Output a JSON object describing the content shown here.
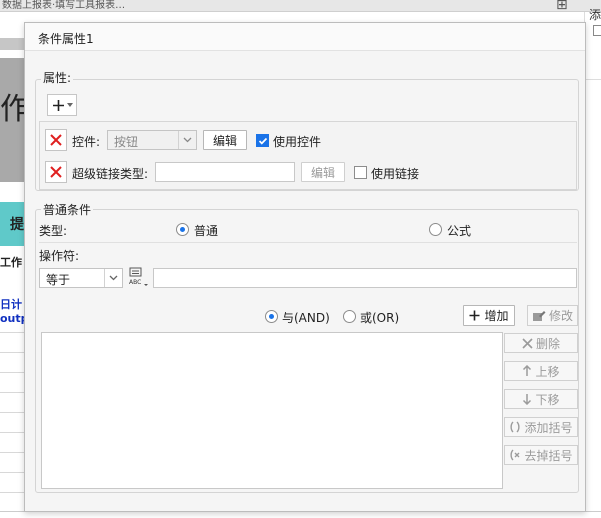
{
  "background": {
    "tab_text": "数据上报表·填写工具报表…",
    "left_big_char": "作",
    "left_teal_char": "提",
    "left_label_1": "工作",
    "left_link_1": "日计",
    "left_link_2": "outp",
    "right_tab_text": "添"
  },
  "dialog": {
    "title": "条件属性1",
    "attributes": {
      "legend": "属性:",
      "add_icon": "plus-icon",
      "rows": [
        {
          "label": "控件:",
          "combo_value": "按钮",
          "edit_label": "编辑",
          "checkbox_label": "使用控件",
          "checked": true
        },
        {
          "label": "超级链接类型:",
          "input_value": "",
          "edit_label": "编辑",
          "checkbox_label": "使用链接",
          "checked": false
        }
      ]
    },
    "common_condition": {
      "legend": "普通条件",
      "type_label": "类型:",
      "type_options": [
        "普通",
        "公式"
      ],
      "type_selected": "普通",
      "operator_label": "操作符:",
      "operator_value": "等于",
      "operator_icon": "abc-formula-icon",
      "operator_input": ""
    },
    "logic": {
      "and_label": "与(AND)",
      "or_label": "或(OR)",
      "selected": "and"
    },
    "buttons": {
      "add": "增加",
      "modify": "修改",
      "delete": "删除",
      "move_up": "上移",
      "move_down": "下移",
      "add_bracket": "添加括号",
      "remove_bracket": "去掉括号"
    },
    "colors": {
      "accent": "#1a73e8",
      "delete_red": "#e02020",
      "disabled_text": "#9b9b9b"
    }
  }
}
